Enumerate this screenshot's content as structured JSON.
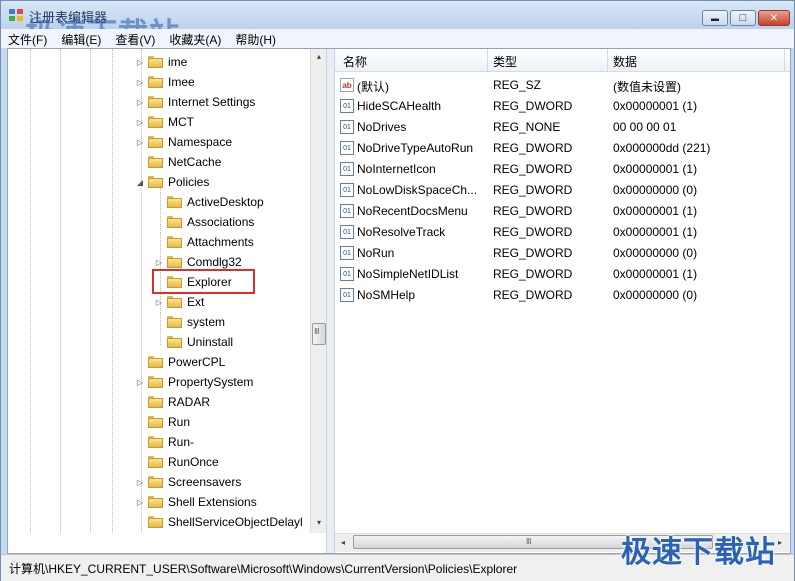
{
  "window": {
    "title": "注册表编辑器",
    "watermark": "极速下载站",
    "minimize_glyph": "▬",
    "maximize_glyph": "□",
    "close_glyph": "✕"
  },
  "menu": [
    "文件(F)",
    "编辑(E)",
    "查看(V)",
    "收藏夹(A)",
    "帮助(H)"
  ],
  "tree": {
    "items": [
      {
        "label": "ime",
        "expander": "▷",
        "depth": 0
      },
      {
        "label": "Imee",
        "expander": "▷",
        "depth": 0
      },
      {
        "label": "Internet Settings",
        "expander": "▷",
        "depth": 0
      },
      {
        "label": "MCT",
        "expander": "▷",
        "depth": 0
      },
      {
        "label": "Namespace",
        "expander": "▷",
        "depth": 0
      },
      {
        "label": "NetCache",
        "expander": "",
        "depth": 0
      },
      {
        "label": "Policies",
        "expander": "◢",
        "depth": 0
      },
      {
        "label": "ActiveDesktop",
        "expander": "",
        "depth": 1
      },
      {
        "label": "Associations",
        "expander": "",
        "depth": 1
      },
      {
        "label": "Attachments",
        "expander": "",
        "depth": 1
      },
      {
        "label": "Comdlg32",
        "expander": "▷",
        "depth": 1
      },
      {
        "label": "Explorer",
        "expander": "",
        "depth": 1,
        "selected": true
      },
      {
        "label": "Ext",
        "expander": "▷",
        "depth": 1
      },
      {
        "label": "system",
        "expander": "",
        "depth": 1
      },
      {
        "label": "Uninstall",
        "expander": "",
        "depth": 1
      },
      {
        "label": "PowerCPL",
        "expander": "",
        "depth": 0
      },
      {
        "label": "PropertySystem",
        "expander": "▷",
        "depth": 0
      },
      {
        "label": "RADAR",
        "expander": "",
        "depth": 0
      },
      {
        "label": "Run",
        "expander": "",
        "depth": 0
      },
      {
        "label": "Run-",
        "expander": "",
        "depth": 0
      },
      {
        "label": "RunOnce",
        "expander": "",
        "depth": 0
      },
      {
        "label": "Screensavers",
        "expander": "▷",
        "depth": 0
      },
      {
        "label": "Shell Extensions",
        "expander": "▷",
        "depth": 0
      },
      {
        "label": "ShellServiceObjectDelayl",
        "expander": "",
        "depth": 0
      }
    ]
  },
  "list": {
    "headers": {
      "name": "名称",
      "type": "类型",
      "data": "数据"
    },
    "rows": [
      {
        "icon": "ab",
        "name": "(默认)",
        "type": "REG_SZ",
        "data": "(数值未设置)"
      },
      {
        "icon": "01",
        "name": "HideSCAHealth",
        "type": "REG_DWORD",
        "data": "0x00000001 (1)"
      },
      {
        "icon": "01",
        "name": "NoDrives",
        "type": "REG_NONE",
        "data": "00 00 00 01"
      },
      {
        "icon": "01",
        "name": "NoDriveTypeAutoRun",
        "type": "REG_DWORD",
        "data": "0x000000dd (221)"
      },
      {
        "icon": "01",
        "name": "NoInternetIcon",
        "type": "REG_DWORD",
        "data": "0x00000001 (1)"
      },
      {
        "icon": "01",
        "name": "NoLowDiskSpaceCh...",
        "type": "REG_DWORD",
        "data": "0x00000000 (0)"
      },
      {
        "icon": "01",
        "name": "NoRecentDocsMenu",
        "type": "REG_DWORD",
        "data": "0x00000001 (1)"
      },
      {
        "icon": "01",
        "name": "NoResolveTrack",
        "type": "REG_DWORD",
        "data": "0x00000001 (1)"
      },
      {
        "icon": "01",
        "name": "NoRun",
        "type": "REG_DWORD",
        "data": "0x00000000 (0)"
      },
      {
        "icon": "01",
        "name": "NoSimpleNetIDList",
        "type": "REG_DWORD",
        "data": "0x00000001 (1)"
      },
      {
        "icon": "01",
        "name": "NoSMHelp",
        "type": "REG_DWORD",
        "data": "0x00000000 (0)"
      }
    ]
  },
  "scroll": {
    "left": "◂",
    "right": "▸",
    "up": "▴",
    "down": "▾",
    "grip": "Ⅲ"
  },
  "status": {
    "path": "计算机\\HKEY_CURRENT_USER\\Software\\Microsoft\\Windows\\CurrentVersion\\Policies\\Explorer"
  },
  "brand": {
    "text": "极速下载站"
  },
  "colors": {
    "highlight": "#d9312a",
    "brand": "#2a63b5"
  }
}
